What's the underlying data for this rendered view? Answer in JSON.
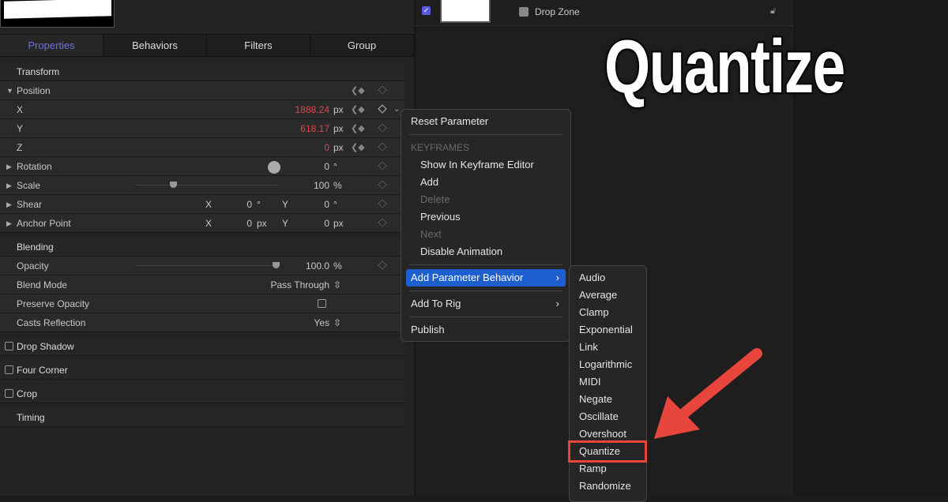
{
  "tabs": [
    "Properties",
    "Behaviors",
    "Filters",
    "Group"
  ],
  "layer": {
    "name": "Drop Zone",
    "checked": true
  },
  "inspector": {
    "transform": "Transform",
    "position": "Position",
    "x": {
      "label": "X",
      "value": "1888.24",
      "unit": "px"
    },
    "y": {
      "label": "Y",
      "value": "618.17",
      "unit": "px"
    },
    "z": {
      "label": "Z",
      "value": "0",
      "unit": "px"
    },
    "rotation": {
      "label": "Rotation",
      "value": "0",
      "unit": "°"
    },
    "scale": {
      "label": "Scale",
      "value": "100",
      "unit": "%"
    },
    "shear": {
      "label": "Shear",
      "x_label": "X",
      "x": "0",
      "x_unit": "°",
      "y_label": "Y",
      "y": "0",
      "y_unit": "°"
    },
    "anchor": {
      "label": "Anchor Point",
      "x_label": "X",
      "x": "0",
      "x_unit": "px",
      "y_label": "Y",
      "y": "0",
      "y_unit": "px"
    },
    "blending": "Blending",
    "opacity": {
      "label": "Opacity",
      "value": "100.0",
      "unit": "%"
    },
    "blend_mode": {
      "label": "Blend Mode",
      "value": "Pass Through"
    },
    "preserve_opacity": {
      "label": "Preserve Opacity",
      "checked": false
    },
    "casts_reflection": {
      "label": "Casts Reflection",
      "value": "Yes"
    },
    "drop_shadow": "Drop Shadow",
    "four_corner": "Four Corner",
    "crop": "Crop",
    "timing": "Timing"
  },
  "menu": {
    "reset": "Reset Parameter",
    "keyframes_header": "KEYFRAMES",
    "show_editor": "Show In Keyframe Editor",
    "add": "Add",
    "delete": "Delete",
    "previous": "Previous",
    "next": "Next",
    "disable": "Disable Animation",
    "add_behavior": "Add Parameter Behavior",
    "add_rig": "Add To Rig",
    "publish": "Publish"
  },
  "submenu": [
    "Audio",
    "Average",
    "Clamp",
    "Exponential",
    "Link",
    "Logarithmic",
    "MIDI",
    "Negate",
    "Oscillate",
    "Overshoot",
    "Quantize",
    "Ramp",
    "Randomize"
  ],
  "highlighted_item": "Quantize",
  "overlay_title": "Quantize",
  "colors": {
    "accent": "#6f6fe8",
    "highlight": "#1d5fcf",
    "annotation": "#e8453c",
    "animated_value": "#e0474c"
  }
}
